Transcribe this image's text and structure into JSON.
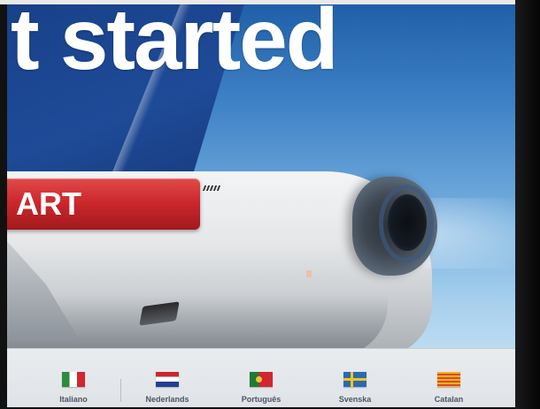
{
  "hero": {
    "headline": "t started"
  },
  "start_button": {
    "label": "ART"
  },
  "languages": [
    {
      "label": "Italiano",
      "flag": "italy-flag-icon",
      "colors": [
        "#2e8a3e",
        "#ffffff",
        "#d0262e"
      ]
    },
    {
      "label": "Nederlands",
      "flag": "netherlands-flag-icon",
      "colors": [
        "#c9262e",
        "#ffffff",
        "#233f92"
      ]
    },
    {
      "label": "Português",
      "flag": "portugal-flag-icon",
      "colors": [
        "#217a33",
        "#d2262e"
      ]
    },
    {
      "label": "Svenska",
      "flag": "sweden-flag-icon",
      "colors": [
        "#2c6ab1",
        "#f0c61e"
      ]
    },
    {
      "label": "Catalan",
      "flag": "catalonia-flag-icon",
      "colors": [
        "#f2b41d",
        "#d94a2a"
      ]
    }
  ],
  "colors": {
    "brand_red": "#c9262a",
    "tail_blue": "#1e4a97",
    "sky_blue": "#79b2e0",
    "language_bar": "#e3e7eb"
  }
}
